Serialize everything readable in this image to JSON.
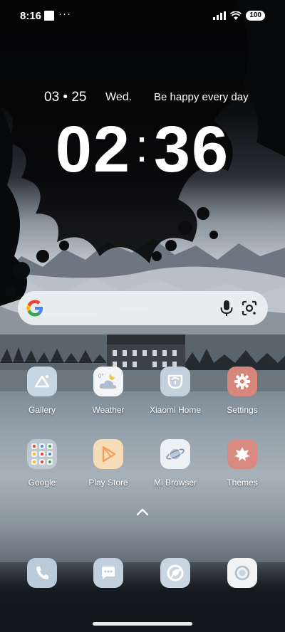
{
  "status_bar": {
    "time": "8:16",
    "dots": "···",
    "battery": "100"
  },
  "widget": {
    "date": "03 • 25",
    "weekday": "Wed.",
    "motto": "Be happy every day",
    "hour": "02",
    "minute": "36",
    "separator": ":"
  },
  "search": {
    "icons": [
      "google-g-icon",
      "microphone-icon",
      "google-lens-icon"
    ]
  },
  "apps_row1": [
    {
      "label": "Gallery",
      "icon": "gallery-icon"
    },
    {
      "label": "Weather",
      "icon": "weather-icon"
    },
    {
      "label": "Xiaomi Home",
      "icon": "xiaomi-home-icon"
    },
    {
      "label": "Settings",
      "icon": "settings-gear-icon"
    }
  ],
  "apps_row2": [
    {
      "label": "Google",
      "icon": "google-folder-icon"
    },
    {
      "label": "Play Store",
      "icon": "play-store-icon"
    },
    {
      "label": "Mi Browser",
      "icon": "mi-browser-icon"
    },
    {
      "label": "Themes",
      "icon": "themes-icon"
    }
  ],
  "dock": [
    {
      "icon": "phone-icon"
    },
    {
      "icon": "messages-icon"
    },
    {
      "icon": "chrome-icon"
    },
    {
      "icon": "camera-icon"
    }
  ],
  "colors": {
    "settings_accent": "#d7867c",
    "themes_accent": "#d98a80",
    "play_accent": "#f0a060",
    "pale_blue": "#c5d2df"
  }
}
